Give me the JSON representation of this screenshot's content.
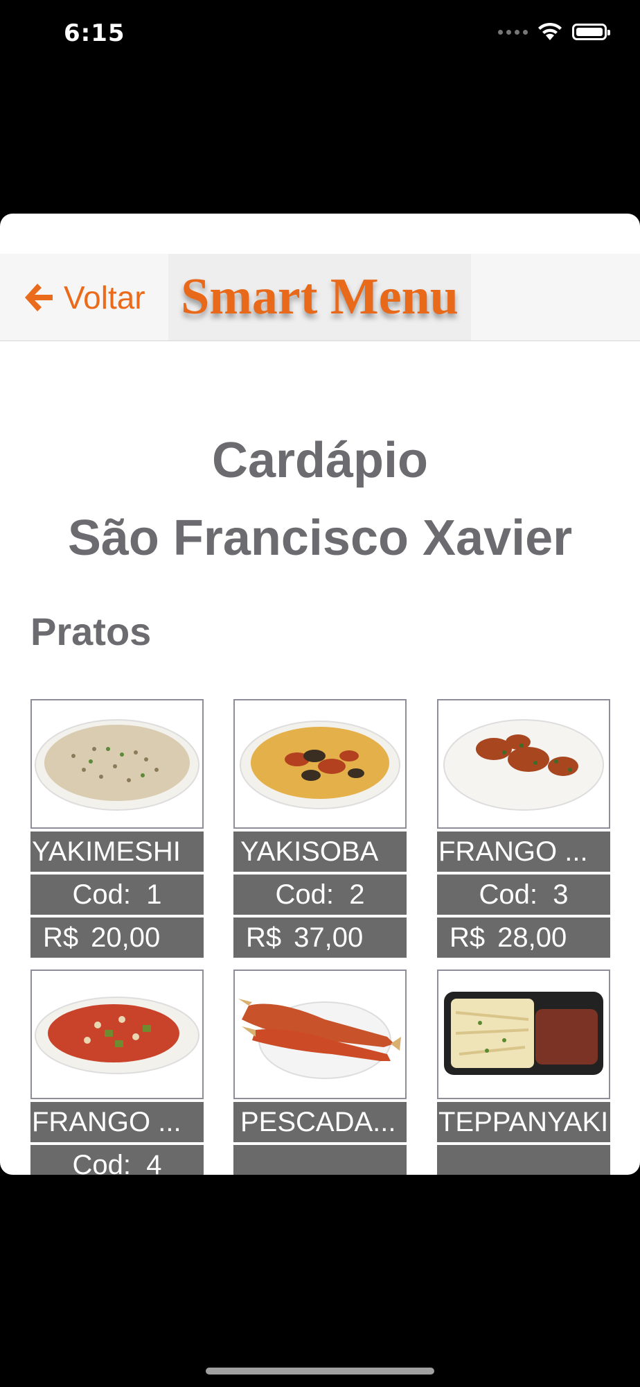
{
  "status": {
    "time": "6:15"
  },
  "nav": {
    "back_label": "Voltar",
    "logo": "Smart Menu"
  },
  "page": {
    "title_line1": "Cardápio",
    "title_line2": "São Francisco Xavier",
    "section": "Pratos"
  },
  "items": [
    {
      "name": "YAKIMESHI",
      "code_label": "Cod:",
      "code": "1",
      "currency": "R$",
      "price": "20,00"
    },
    {
      "name": "YAKISOBA",
      "code_label": "Cod:",
      "code": "2",
      "currency": "R$",
      "price": "37,00"
    },
    {
      "name": "FRANGO ...",
      "code_label": "Cod:",
      "code": "3",
      "currency": "R$",
      "price": "28,00"
    },
    {
      "name": "FRANGO ...",
      "code_label": "Cod:",
      "code": "4"
    },
    {
      "name": "PESCADA..."
    },
    {
      "name": "TEPPANYAKI"
    }
  ],
  "colors": {
    "accent": "#ea6b1b",
    "heading": "#6c6c70",
    "cell_bg": "#6a6a6a"
  },
  "icons": {
    "back": "arrow-left-icon",
    "wifi": "wifi-icon",
    "battery": "battery-icon",
    "signal": "signal-icon"
  }
}
